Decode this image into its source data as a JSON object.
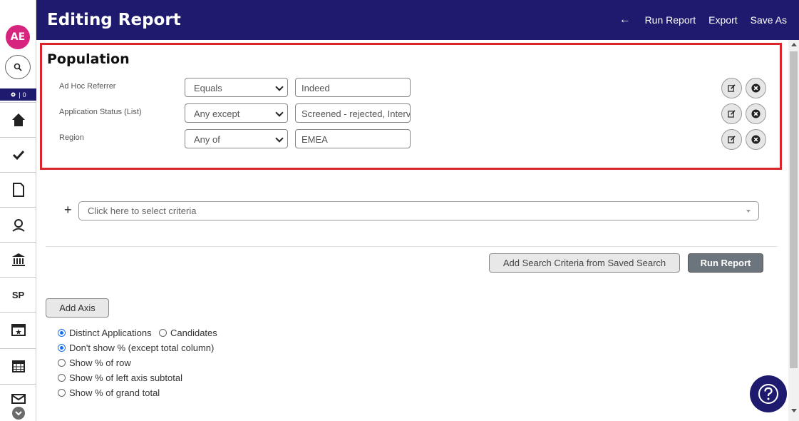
{
  "rail": {
    "avatar_initials": "AE",
    "badge_count": "0",
    "sp_label": "SP"
  },
  "header": {
    "title": "Editing Report",
    "run_report": "Run Report",
    "export": "Export",
    "save_as": "Save As"
  },
  "population": {
    "title": "Population",
    "criteria": [
      {
        "label": "Ad Hoc Referrer",
        "operator": "Equals",
        "value": "Indeed"
      },
      {
        "label": "Application Status (List)",
        "operator": "Any except",
        "value": "Screened - rejected, Interv"
      },
      {
        "label": "Region",
        "operator": "Any of",
        "value": "EMEA"
      }
    ]
  },
  "criteria_select": {
    "placeholder": "Click here to select criteria"
  },
  "buttons": {
    "add_saved_search": "Add Search Criteria from Saved Search",
    "run_report": "Run Report",
    "add_axis": "Add Axis"
  },
  "options": {
    "count_by": [
      {
        "label": "Distinct Applications",
        "selected": true
      },
      {
        "label": "Candidates",
        "selected": false
      }
    ],
    "percent": [
      {
        "label": "Don't show % (except total column)",
        "selected": true
      },
      {
        "label": "Show % of row",
        "selected": false
      },
      {
        "label": "Show % of left axis subtotal",
        "selected": false
      },
      {
        "label": "Show % of grand total",
        "selected": false
      }
    ]
  },
  "colors": {
    "header_bg": "#1e1b6e",
    "avatar_bg": "#d6247f",
    "highlight_border": "#d9262c",
    "radio_selected": "#1a73e8"
  }
}
